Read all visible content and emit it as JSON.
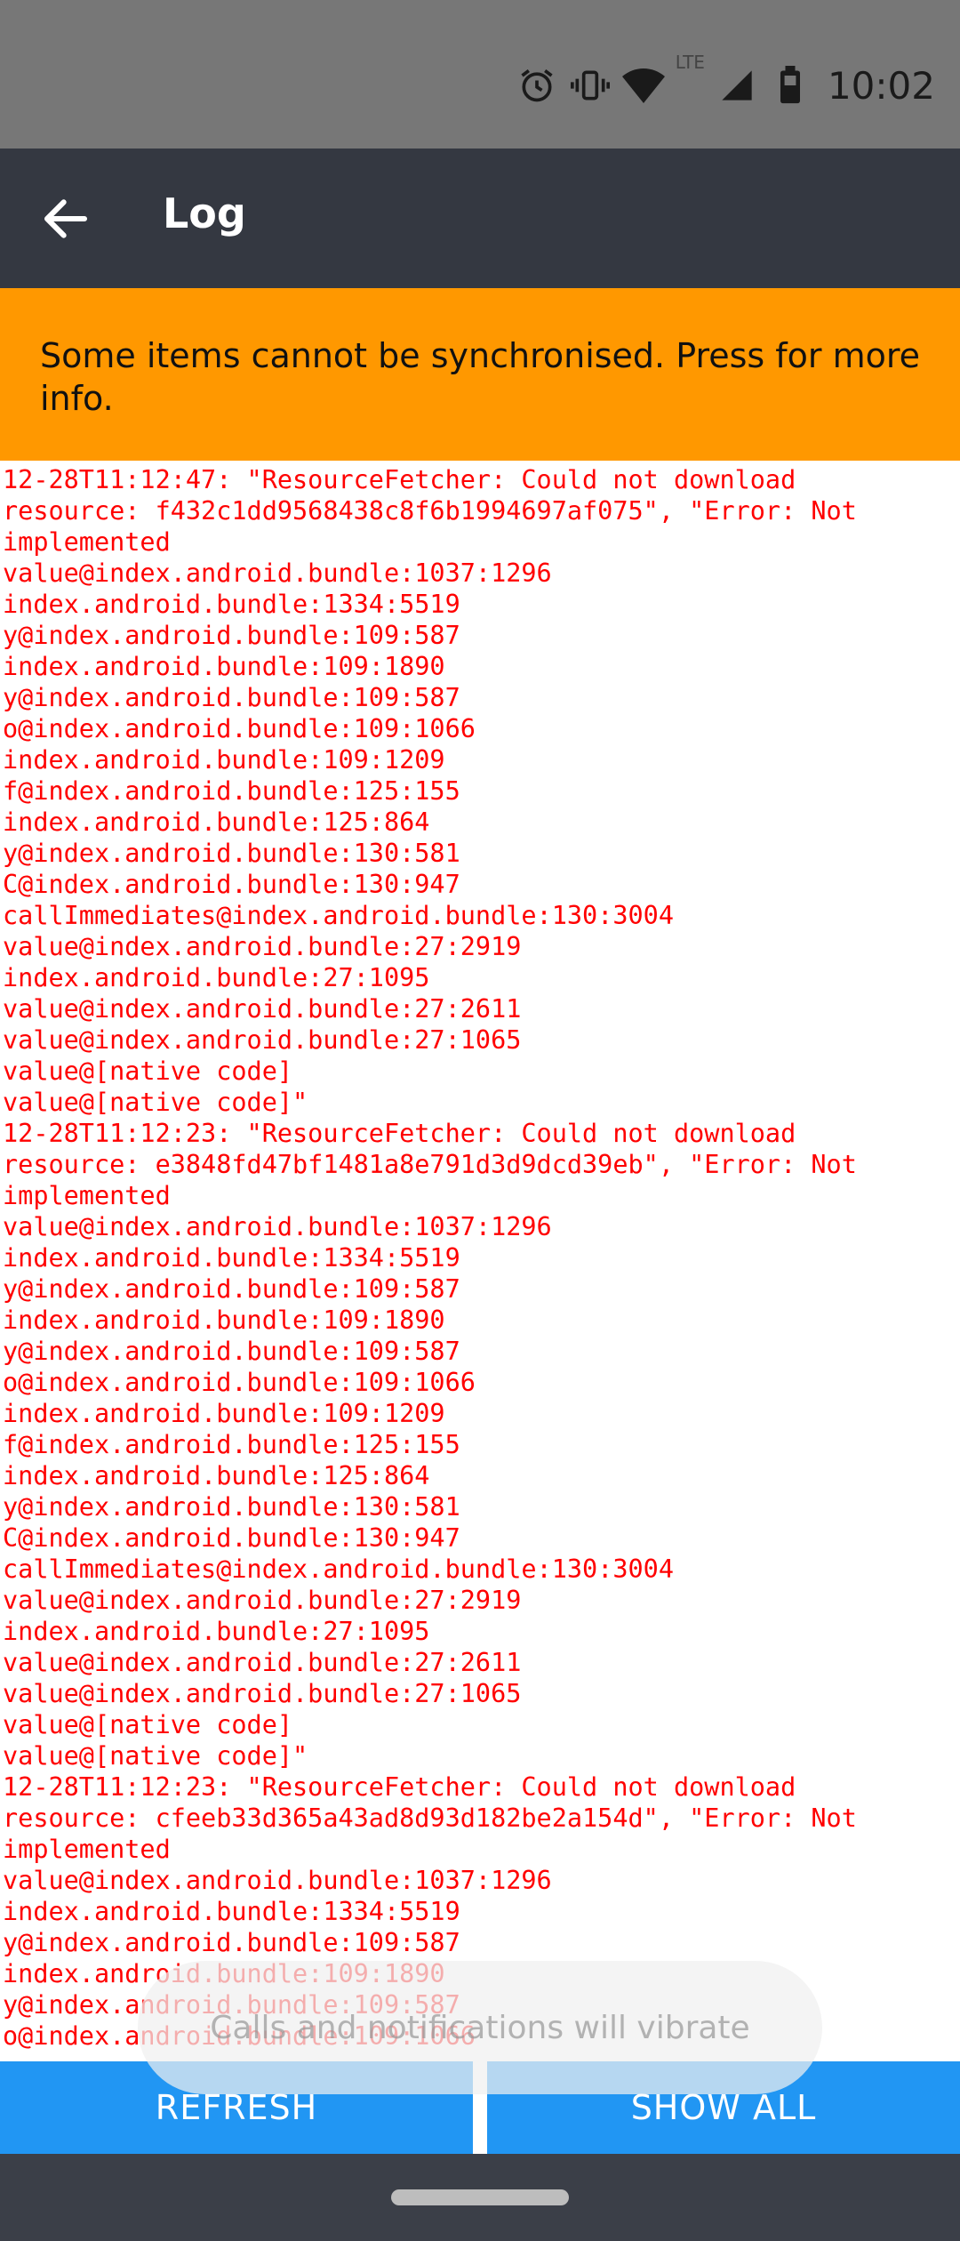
{
  "status": {
    "time": "10:02",
    "network": "LTE",
    "icons": [
      "alarm-icon",
      "vibrate-icon",
      "wifi-icon",
      "signal-icon",
      "battery-icon"
    ]
  },
  "appbar": {
    "title": "Log",
    "back_icon": "arrow-left-icon"
  },
  "warning": {
    "text": "Some items cannot be synchronised. Press for more info."
  },
  "log": {
    "lines": [
      "12-28T11:12:47: \"ResourceFetcher: Could not download",
      "resource: f432c1dd9568438c8f6b1994697af075\", \"Error: Not",
      "implemented",
      "value@index.android.bundle:1037:1296",
      "index.android.bundle:1334:5519",
      "y@index.android.bundle:109:587",
      "index.android.bundle:109:1890",
      "y@index.android.bundle:109:587",
      "o@index.android.bundle:109:1066",
      "index.android.bundle:109:1209",
      "f@index.android.bundle:125:155",
      "index.android.bundle:125:864",
      "y@index.android.bundle:130:581",
      "C@index.android.bundle:130:947",
      "callImmediates@index.android.bundle:130:3004",
      "value@index.android.bundle:27:2919",
      "index.android.bundle:27:1095",
      "value@index.android.bundle:27:2611",
      "value@index.android.bundle:27:1065",
      "value@[native code]",
      "value@[native code]\"",
      "12-28T11:12:23: \"ResourceFetcher: Could not download",
      "resource: e3848fd47bf1481a8e791d3d9dcd39eb\", \"Error: Not",
      "implemented",
      "value@index.android.bundle:1037:1296",
      "index.android.bundle:1334:5519",
      "y@index.android.bundle:109:587",
      "index.android.bundle:109:1890",
      "y@index.android.bundle:109:587",
      "o@index.android.bundle:109:1066",
      "index.android.bundle:109:1209",
      "f@index.android.bundle:125:155",
      "index.android.bundle:125:864",
      "y@index.android.bundle:130:581",
      "C@index.android.bundle:130:947",
      "callImmediates@index.android.bundle:130:3004",
      "value@index.android.bundle:27:2919",
      "index.android.bundle:27:1095",
      "value@index.android.bundle:27:2611",
      "value@index.android.bundle:27:1065",
      "value@[native code]",
      "value@[native code]\"",
      "12-28T11:12:23: \"ResourceFetcher: Could not download",
      "resource: cfeeb33d365a43ad8d93d182be2a154d\", \"Error: Not",
      "implemented",
      "value@index.android.bundle:1037:1296",
      "index.android.bundle:1334:5519",
      "y@index.android.bundle:109:587",
      "index.android.bundle:109:1890",
      "y@index.android.bundle:109:587",
      "o@index.android.bundle:109:1066"
    ]
  },
  "toast": {
    "text": "Calls and notifications will vibrate"
  },
  "buttons": {
    "refresh": "REFRESH",
    "show_all": "SHOW ALL"
  },
  "colors": {
    "appbar": "#343841",
    "warning": "#FF9800",
    "log_text": "#ff0000",
    "button": "#2196F3"
  }
}
